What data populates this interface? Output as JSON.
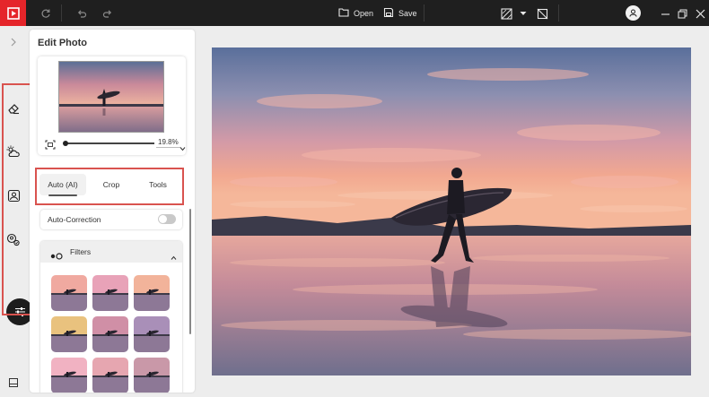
{
  "app": {
    "accent": "#e5252a",
    "topbar_color": "#1f1f1f",
    "highlight_color": "#d9534f"
  },
  "toolbar": {
    "open_label": "Open",
    "save_label": "Save",
    "icons": [
      "logo-icon",
      "refresh-icon",
      "undo-icon",
      "redo-icon",
      "folder-icon",
      "save-icon",
      "compare-icon",
      "chevron-down-icon",
      "crop-off-icon",
      "avatar-icon",
      "minimize-icon",
      "maximize-icon",
      "close-icon"
    ]
  },
  "rail": {
    "icons": [
      "expand-chevron-icon",
      "eraser-icon",
      "weather-sky-icon",
      "portrait-icon",
      "face-retouch-icon",
      "adjust-sliders-icon",
      "panel-toggle-icon"
    ],
    "active": "adjust-sliders-icon"
  },
  "panel": {
    "title": "Edit Photo",
    "zoom_value": "19.8%",
    "tabs": [
      {
        "label": "Auto (AI)",
        "active": true
      },
      {
        "label": "Crop",
        "active": false
      },
      {
        "label": "Tools",
        "active": false
      }
    ],
    "auto_correction": {
      "label": "Auto-Correction",
      "enabled": false
    },
    "filters": {
      "label": "Filters",
      "expanded": true,
      "count_visible": 9
    }
  }
}
